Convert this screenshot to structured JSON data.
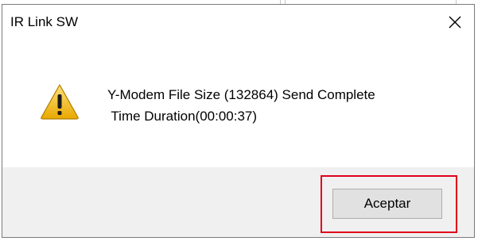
{
  "dialog": {
    "title": "IR Link SW",
    "close_icon": "close-icon",
    "message_line1": "Y-Modem File Size (132864) Send Complete",
    "message_line2": " Time Duration(00:00:37)",
    "warning_icon": "warning-icon",
    "ok_button_label": "Aceptar"
  },
  "colors": {
    "highlight": "#e0001a",
    "warning_fill": "#f5c518",
    "footer_bg": "#f0f0f0"
  }
}
